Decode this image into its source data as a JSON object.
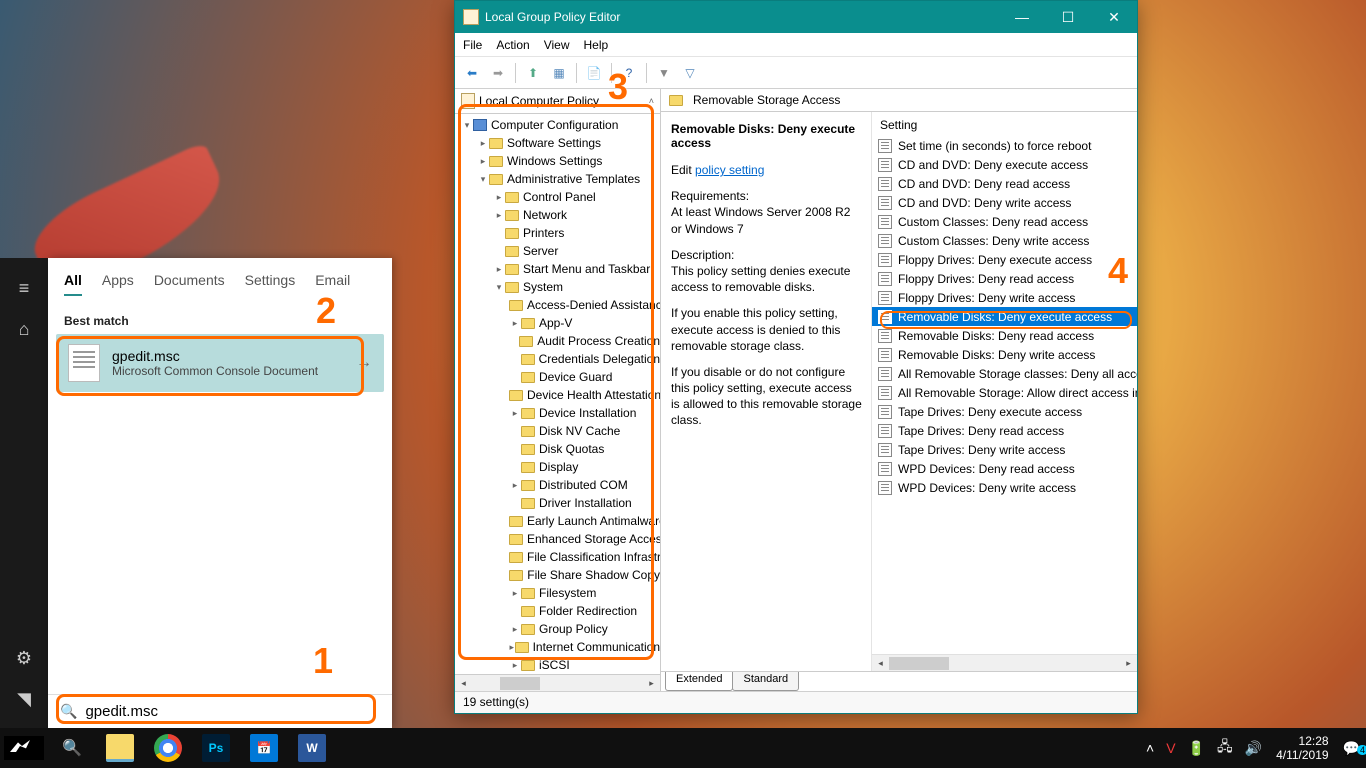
{
  "annotations": {
    "n1": "1",
    "n2": "2",
    "n3": "3",
    "n4": "4"
  },
  "search": {
    "tabs": {
      "all": "All",
      "apps": "Apps",
      "documents": "Documents",
      "settings": "Settings",
      "email": "Email"
    },
    "best_match": "Best match",
    "result_title": "gpedit.msc",
    "result_sub": "Microsoft Common Console Document",
    "input_value": "gpedit.msc"
  },
  "gpedit": {
    "title": "Local Group Policy Editor",
    "menus": {
      "file": "File",
      "action": "Action",
      "view": "View",
      "help": "Help"
    },
    "tree_root": "Local Computer Policy",
    "tree": {
      "comp_config": "Computer Configuration",
      "software_settings": "Software Settings",
      "windows_settings": "Windows Settings",
      "admin_templates": "Administrative Templates",
      "control_panel": "Control Panel",
      "network": "Network",
      "printers": "Printers",
      "server": "Server",
      "start_menu": "Start Menu and Taskbar",
      "system": "System",
      "access_denied": "Access-Denied Assistance",
      "app_v": "App-V",
      "audit_process": "Audit Process Creation",
      "credentials_deleg": "Credentials Delegation",
      "device_guard": "Device Guard",
      "device_health": "Device Health Attestation",
      "device_install": "Device Installation",
      "disk_nv": "Disk NV Cache",
      "disk_quotas": "Disk Quotas",
      "display": "Display",
      "distributed_com": "Distributed COM",
      "driver_install": "Driver Installation",
      "early_launch": "Early Launch Antimalware",
      "enhanced_storage": "Enhanced Storage Access",
      "file_classification": "File Classification Infrastructure",
      "file_share_shadow": "File Share Shadow Copy",
      "filesystem": "Filesystem",
      "folder_redirection": "Folder Redirection",
      "group_policy": "Group Policy",
      "internet_comm": "Internet Communication",
      "iscsi": "iSCSI"
    },
    "right_header": "Removable Storage Access",
    "desc": {
      "title": "Removable Disks: Deny execute access",
      "edit_prefix": "Edit",
      "edit_link": "policy setting",
      "req_label": "Requirements:",
      "req_text": "At least Windows Server 2008 R2 or Windows 7",
      "desc_label": "Description:",
      "desc_text": "This policy setting denies execute access to removable disks.",
      "enable_text": "If you enable this policy setting, execute access is denied to this removable storage class.",
      "disable_text": "If you disable or do not configure this policy setting, execute access is allowed to this removable storage class."
    },
    "settings_header": "Setting",
    "settings": [
      "Set time (in seconds) to force reboot",
      "CD and DVD: Deny execute access",
      "CD and DVD: Deny read access",
      "CD and DVD: Deny write access",
      "Custom Classes: Deny read access",
      "Custom Classes: Deny write access",
      "Floppy Drives: Deny execute access",
      "Floppy Drives: Deny read access",
      "Floppy Drives: Deny write access",
      "Removable Disks: Deny execute access",
      "Removable Disks: Deny read access",
      "Removable Disks: Deny write access",
      "All Removable Storage classes: Deny all access",
      "All Removable Storage: Allow direct access in remote sessions",
      "Tape Drives: Deny execute access",
      "Tape Drives: Deny read access",
      "Tape Drives: Deny write access",
      "WPD Devices: Deny read access",
      "WPD Devices: Deny write access"
    ],
    "selected_setting_index": 9,
    "tabs": {
      "extended": "Extended",
      "standard": "Standard"
    },
    "status": "19 setting(s)"
  },
  "taskbar": {
    "time": "12:28",
    "date": "4/11/2019"
  }
}
